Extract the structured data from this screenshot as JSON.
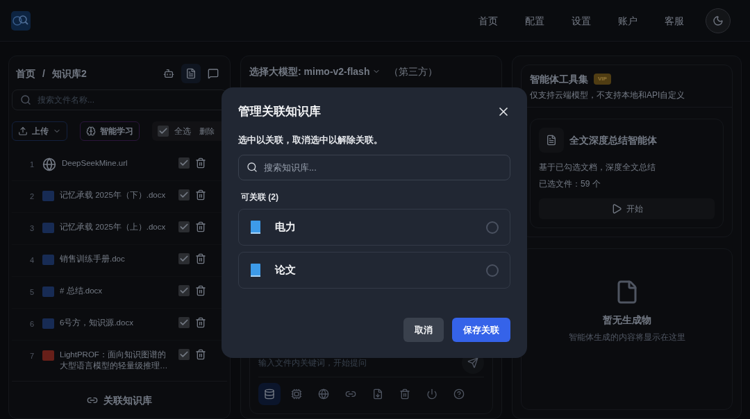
{
  "nav": {
    "items": [
      {
        "label": "首页"
      },
      {
        "label": "配置"
      },
      {
        "label": "设置"
      },
      {
        "label": "账户"
      },
      {
        "label": "客服"
      }
    ]
  },
  "library": {
    "breadcrumb": [
      "首页",
      "/",
      "知识库2"
    ],
    "views": [
      {
        "kind": "bot",
        "selected": false
      },
      {
        "kind": "file",
        "selected": true
      },
      {
        "kind": "chat",
        "selected": false
      }
    ],
    "search": {
      "placeholder": "搜索文件名称..."
    },
    "upload": "上传",
    "learn": "智能学习",
    "select_all": {
      "label": "全选",
      "checked": true
    },
    "delete": "删除",
    "files": [
      {
        "index": "1",
        "kind": "url",
        "name": "DeepSeekMine.url",
        "checked": true
      },
      {
        "index": "2",
        "kind": "word",
        "name": "记忆承载 2025年（下）.docx",
        "checked": true
      },
      {
        "index": "3",
        "kind": "word",
        "name": "记忆承载 2025年（上）.docx",
        "checked": true
      },
      {
        "index": "4",
        "kind": "word",
        "name": "销售训练手册.doc",
        "checked": true
      },
      {
        "index": "5",
        "kind": "word",
        "name": "# 总结.docx",
        "checked": true
      },
      {
        "index": "6",
        "kind": "word",
        "name": "6号方，知识源.docx",
        "checked": true
      },
      {
        "index": "7",
        "kind": "pdf",
        "name": "LightPROF：面向知识图谱的大型语言模型的轻量级推理…",
        "checked": true
      }
    ],
    "link_button": "关联知识库"
  },
  "chat": {
    "model_label": "选择大模型: mimo-v2-flash",
    "model_note": "（第三方）",
    "input": {
      "placeholder": "输入文件内关键词，开始提问"
    },
    "tools": [
      {
        "kind": "database",
        "selected": true
      },
      {
        "kind": "chip",
        "selected": false
      },
      {
        "kind": "globe",
        "selected": false
      },
      {
        "kind": "link",
        "selected": false
      },
      {
        "kind": "file-download",
        "selected": false
      },
      {
        "kind": "trash",
        "selected": false
      },
      {
        "kind": "power",
        "selected": false
      },
      {
        "kind": "help",
        "selected": false
      }
    ]
  },
  "agents": {
    "title": "智能体工具集",
    "badge": "VIP",
    "subtitle": "仅支持云端模型，不支持本地和API自定义",
    "card": {
      "title": "全文深度总结智能体",
      "description": "基于已勾选文档，深度全文总结",
      "selected_files": "已选文件：59 个",
      "start": "开始"
    },
    "empty": {
      "title": "暂无生成物",
      "text": "智能体生成的内容将显示在这里"
    }
  },
  "dialog": {
    "title": "管理关联知识库",
    "hint": "选中以关联，取消选中以解除关联。",
    "search": {
      "placeholder": "搜索知识库..."
    },
    "section": "可关联 (2)",
    "libraries": [
      {
        "name": "电力",
        "selected": false
      },
      {
        "name": "论文",
        "selected": false
      }
    ],
    "cancel": "取消",
    "save": "保存关联"
  }
}
